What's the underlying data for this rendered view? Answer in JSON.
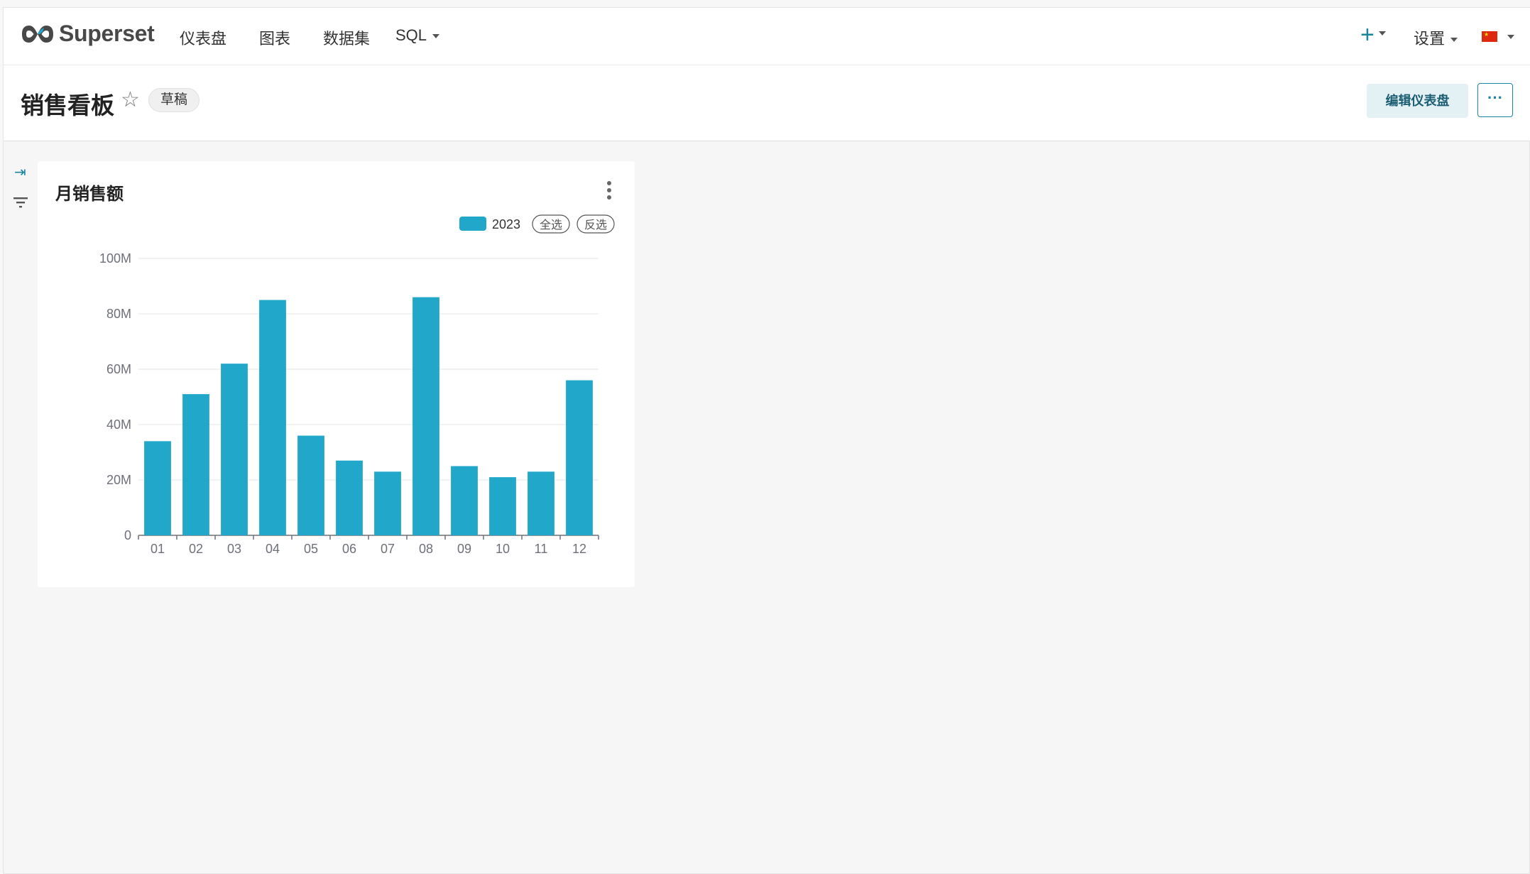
{
  "app": {
    "brand": "Superset",
    "nav": [
      {
        "label": "仪表盘"
      },
      {
        "label": "图表"
      },
      {
        "label": "数据集"
      },
      {
        "label": "SQL"
      }
    ],
    "plus": "+",
    "settings": "设置",
    "language_flag": "cn-flag-icon"
  },
  "dashboard": {
    "title": "销售看板",
    "status_badge": "草稿",
    "edit_button": "编辑仪表盘",
    "more_button": "···"
  },
  "chart_card": {
    "title": "月销售额",
    "legend_select_all": "全选",
    "legend_invert": "反选"
  },
  "colors": {
    "accent": "#1a85a0",
    "bar": "#20a7c9"
  },
  "chart_data": {
    "type": "bar",
    "categories": [
      "01",
      "02",
      "03",
      "04",
      "05",
      "06",
      "07",
      "08",
      "09",
      "10",
      "11",
      "12"
    ],
    "series": [
      {
        "name": "2023",
        "values": [
          34,
          51,
          62,
          85,
          36,
          27,
          23,
          86,
          25,
          21,
          23,
          56
        ]
      }
    ],
    "y_ticks": [
      "0",
      "20M",
      "40M",
      "60M",
      "80M",
      "100M"
    ],
    "ylim": [
      0,
      100
    ],
    "y_unit": "M",
    "legend_position": "top-right",
    "grid": true
  }
}
